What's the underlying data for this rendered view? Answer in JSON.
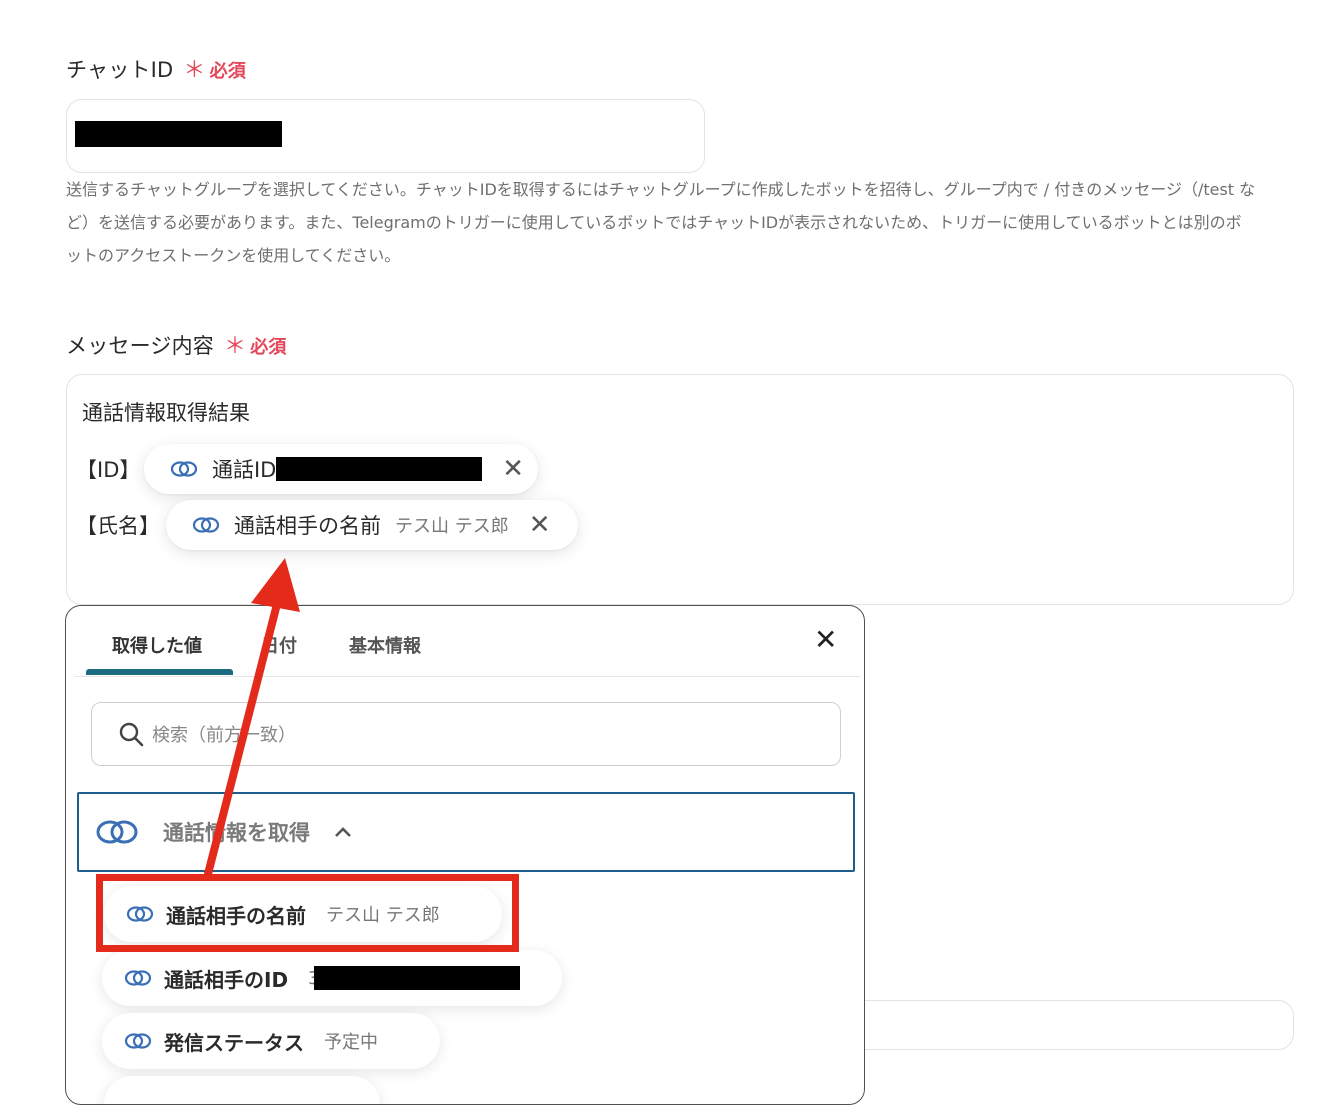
{
  "chat_id": {
    "label": "チャットID",
    "required_mark": "＊",
    "required_text": "必須",
    "help_lines": [
      "送信するチャットグループを選択してください。チャットIDを取得するにはチャットグループに作成したボットを招待し、グループ内で / 付きのメッセージ（/test な",
      "ど）を送信する必要があります。また、Telegramのトリガーに使用しているボットではチャットIDが表示されないため、トリガーに使用しているボットとは別のボ",
      "ットのアクセストークンを使用してください。"
    ]
  },
  "message": {
    "label": "メッセージ内容",
    "required_mark": "＊",
    "required_text": "必須",
    "title_line": "通話情報取得結果",
    "id_prefix": "【ID】",
    "name_prefix": "【氏名】",
    "chip_id_label": "通話ID",
    "chip_name_label": "通話相手の名前",
    "chip_name_value": "テス山 テス郎",
    "chip_remove_glyph": "✕"
  },
  "popup": {
    "tabs": [
      "取得した値",
      "日付",
      "基本情報"
    ],
    "active_tab": 0,
    "close_glyph": "✕",
    "search_placeholder": "検索（前方一致）",
    "group_title": "通話情報を取得",
    "group_toggle_glyph": "⌃",
    "options": [
      {
        "label": "通話相手の名前",
        "value": "テス山 テス郎",
        "highlighted": true
      },
      {
        "label": "通話相手のID",
        "value": "3"
      },
      {
        "label": "発信ステータス",
        "value": "予定中"
      }
    ]
  },
  "colors": {
    "required": "#e4485a",
    "tab_underline": "#1b6a82",
    "group_border": "#1d5f8a",
    "annotation_red": "#e42a1b",
    "link_icon": "#3a6fb5"
  },
  "icons": {
    "link": "link-chain-icon",
    "search": "search-icon",
    "close": "close-icon",
    "chevron": "chevron-up-icon"
  }
}
